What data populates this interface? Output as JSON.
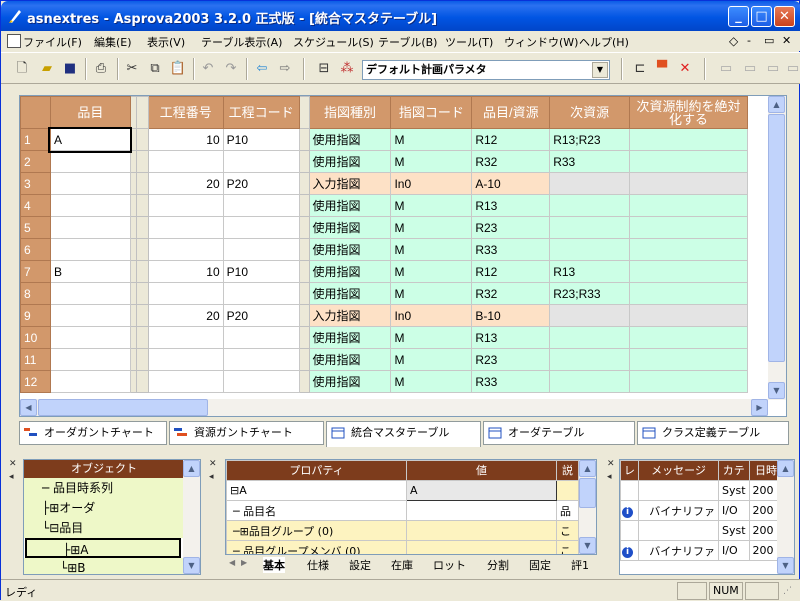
{
  "title": "asnextres - Asprova2003 3.2.0 正式版 - [統合マスタテーブル]",
  "menu": [
    "ファイル(F)",
    "編集(E)",
    "表示(V)",
    "テーブル表示(A)",
    "スケジュール(S)",
    "テーブル(B)",
    "ツール(T)",
    "ウィンドウ(W)",
    "ヘルプ(H)"
  ],
  "toolbar": {
    "param_value": "デフォルト計画パラメタ"
  },
  "grid": {
    "headers": [
      "品目",
      "工程番号",
      "工程コード",
      "指図種別",
      "指図コード",
      "品目/資源",
      "次資源",
      "次資源制約を絶対化する"
    ],
    "rows": [
      {
        "n": "1",
        "item": "A",
        "procno": "10",
        "proccode": "P10",
        "type": "使用指図",
        "code": "M",
        "res": "R12",
        "next": "R13;R23",
        "kind": "gr"
      },
      {
        "n": "2",
        "item": "",
        "procno": "",
        "proccode": "",
        "type": "使用指図",
        "code": "M",
        "res": "R32",
        "next": "R33",
        "kind": "gr"
      },
      {
        "n": "3",
        "item": "",
        "procno": "20",
        "proccode": "P20",
        "type": "入力指図",
        "code": "In0",
        "res": "A-10",
        "next": "",
        "kind": "pk"
      },
      {
        "n": "4",
        "item": "",
        "procno": "",
        "proccode": "",
        "type": "使用指図",
        "code": "M",
        "res": "R13",
        "next": "",
        "kind": "gr"
      },
      {
        "n": "5",
        "item": "",
        "procno": "",
        "proccode": "",
        "type": "使用指図",
        "code": "M",
        "res": "R23",
        "next": "",
        "kind": "gr"
      },
      {
        "n": "6",
        "item": "",
        "procno": "",
        "proccode": "",
        "type": "使用指図",
        "code": "M",
        "res": "R33",
        "next": "",
        "kind": "gr"
      },
      {
        "n": "7",
        "item": "B",
        "procno": "10",
        "proccode": "P10",
        "type": "使用指図",
        "code": "M",
        "res": "R12",
        "next": "R13",
        "kind": "gr"
      },
      {
        "n": "8",
        "item": "",
        "procno": "",
        "proccode": "",
        "type": "使用指図",
        "code": "M",
        "res": "R32",
        "next": "R23;R33",
        "kind": "gr"
      },
      {
        "n": "9",
        "item": "",
        "procno": "20",
        "proccode": "P20",
        "type": "入力指図",
        "code": "In0",
        "res": "B-10",
        "next": "",
        "kind": "pk"
      },
      {
        "n": "10",
        "item": "",
        "procno": "",
        "proccode": "",
        "type": "使用指図",
        "code": "M",
        "res": "R13",
        "next": "",
        "kind": "gr"
      },
      {
        "n": "11",
        "item": "",
        "procno": "",
        "proccode": "",
        "type": "使用指図",
        "code": "M",
        "res": "R23",
        "next": "",
        "kind": "gr"
      },
      {
        "n": "12",
        "item": "",
        "procno": "",
        "proccode": "",
        "type": "使用指図",
        "code": "M",
        "res": "R33",
        "next": "",
        "kind": "gr"
      }
    ]
  },
  "tabs": [
    "オーダガントチャート",
    "資源ガントチャート",
    "統合マスタテーブル",
    "オーダテーブル",
    "クラス定義テーブル"
  ],
  "object_pane": {
    "header": "オブジェクト",
    "items": [
      "品目時系列",
      "オーダ",
      "品目",
      "A",
      "B"
    ]
  },
  "property_pane": {
    "headers": [
      "プロパティ",
      "値",
      "説"
    ],
    "rows": [
      {
        "name": "A",
        "value": "A",
        "note": ""
      },
      {
        "name": "品目名",
        "value": "",
        "note": "品"
      },
      {
        "name": "品目グループ (0)",
        "value": "",
        "note": "こ"
      },
      {
        "name": "品目グループメンバ (0)",
        "value": "",
        "note": "こ"
      }
    ],
    "tabs": [
      "基本",
      "仕様",
      "設定",
      "在庫",
      "ロット",
      "分割",
      "固定",
      "評1"
    ]
  },
  "message_pane": {
    "headers": [
      "レ",
      "メッセージ",
      "カテ",
      "日時"
    ],
    "rows": [
      {
        "lvl": "",
        "msg": "",
        "cat": "Syst",
        "date": "200"
      },
      {
        "lvl": "i",
        "msg": "バイナリファ",
        "cat": "I/O",
        "date": "200"
      },
      {
        "lvl": "",
        "msg": "",
        "cat": "Syst",
        "date": "200"
      },
      {
        "lvl": "i",
        "msg": "バイナリファ",
        "cat": "I/O",
        "date": "200"
      }
    ]
  },
  "status": {
    "left": "レディ",
    "num": "NUM"
  }
}
